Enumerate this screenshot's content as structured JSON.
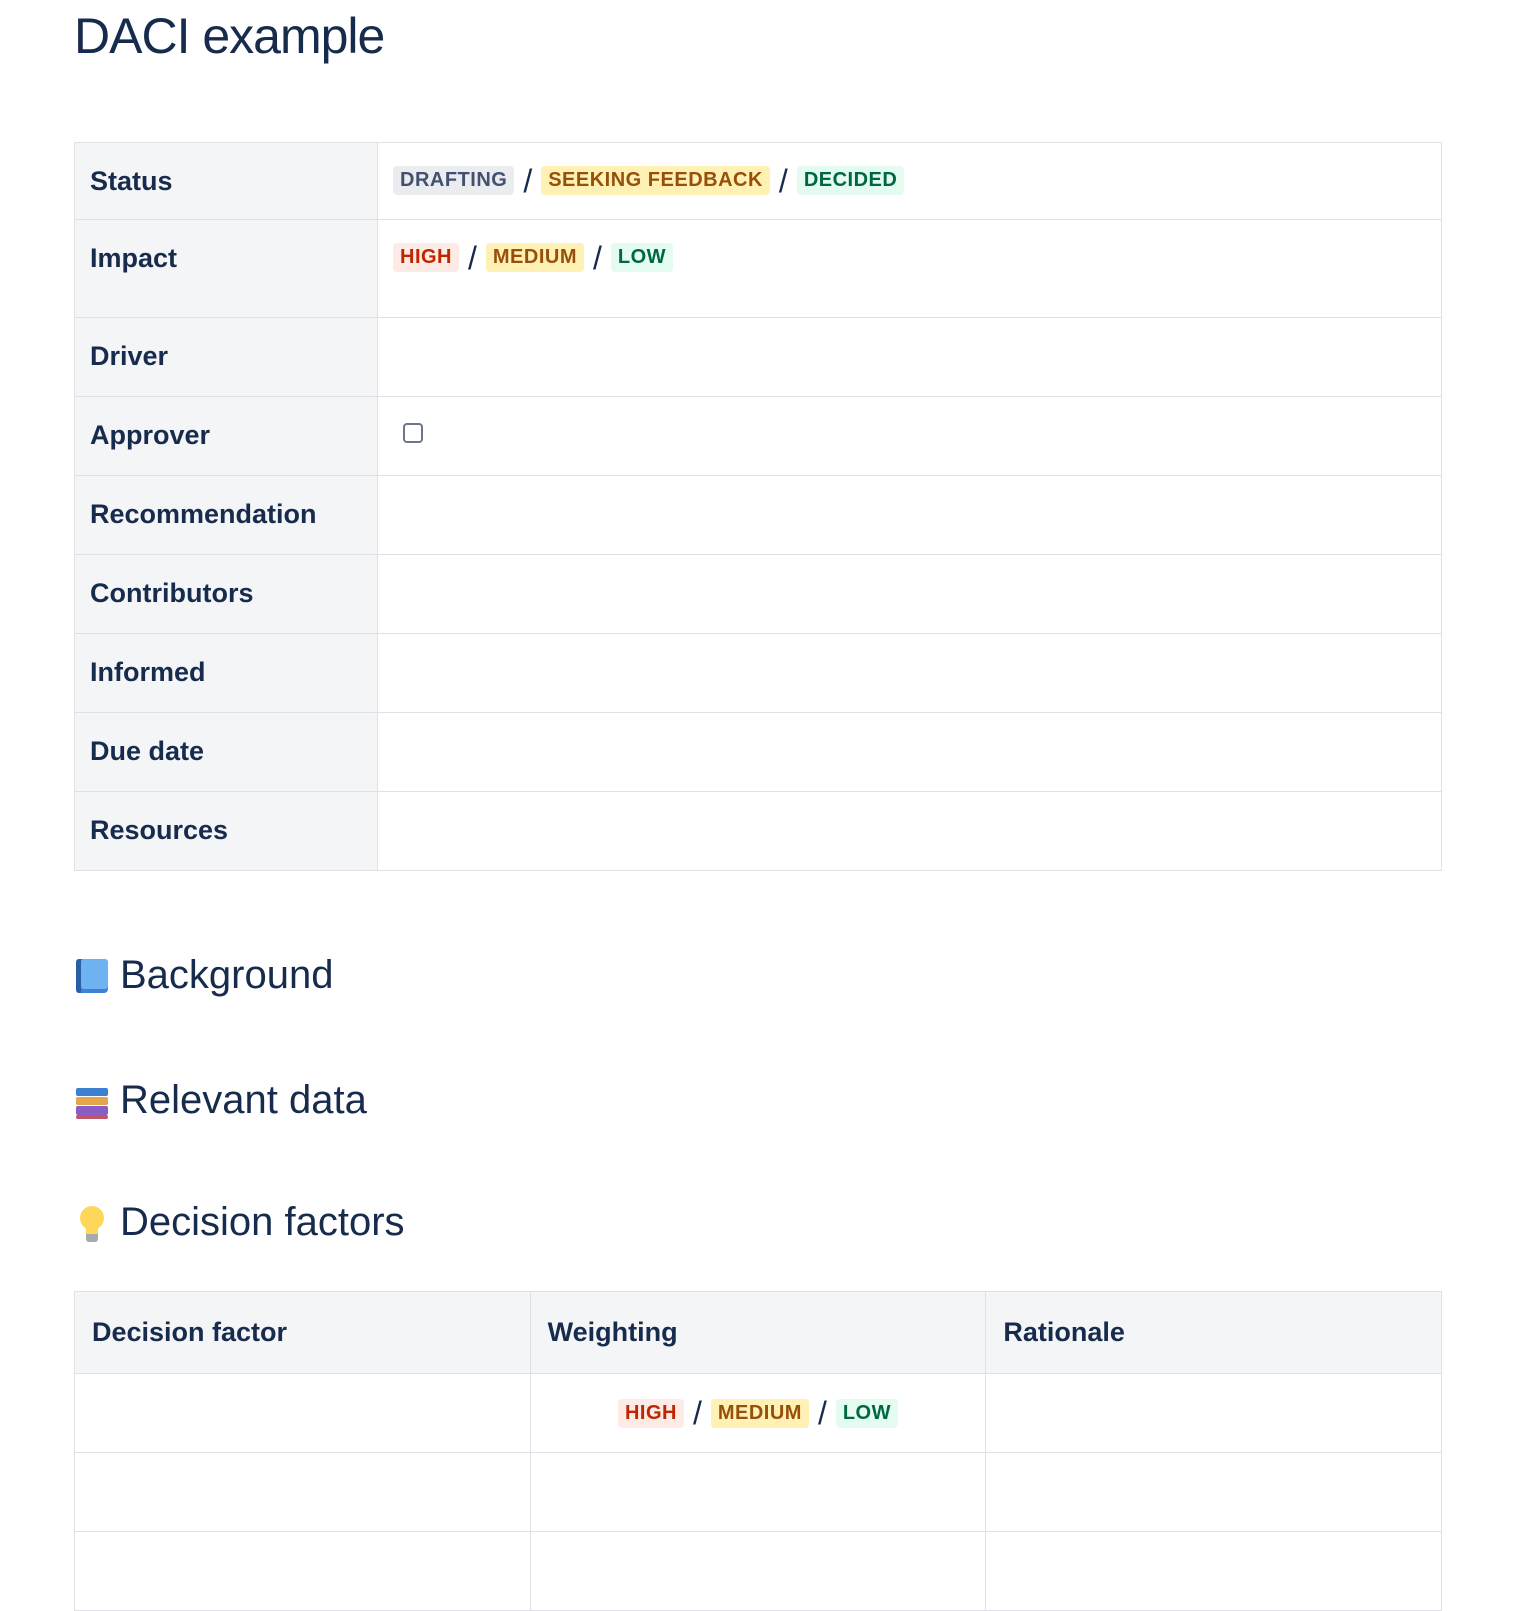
{
  "page": {
    "title": "DACI example"
  },
  "properties": {
    "status": {
      "label": "Status",
      "options": [
        "DRAFTING",
        "SEEKING FEEDBACK",
        "DECIDED"
      ]
    },
    "impact": {
      "label": "Impact",
      "options": [
        "HIGH",
        "MEDIUM",
        "LOW"
      ]
    },
    "driver": {
      "label": "Driver",
      "value": ""
    },
    "approver": {
      "label": "Approver",
      "checked": false
    },
    "recommendation": {
      "label": "Recommendation",
      "value": ""
    },
    "contributors": {
      "label": "Contributors",
      "value": ""
    },
    "informed": {
      "label": "Informed",
      "value": ""
    },
    "due_date": {
      "label": "Due date",
      "value": ""
    },
    "resources": {
      "label": "Resources",
      "value": ""
    },
    "separator": "/"
  },
  "sections": {
    "background": {
      "title": "Background",
      "icon": "blue-book-icon"
    },
    "relevant_data": {
      "title": "Relevant data",
      "icon": "books-icon"
    },
    "decision_factors": {
      "title": "Decision factors",
      "icon": "light-bulb-icon"
    }
  },
  "factors_table": {
    "headers": [
      "Decision factor",
      "Weighting",
      "Rationale"
    ],
    "rows": [
      {
        "factor": "",
        "weighting": [
          "HIGH",
          "MEDIUM",
          "LOW"
        ],
        "rationale": ""
      },
      {
        "factor": "",
        "weighting": [],
        "rationale": ""
      },
      {
        "factor": "",
        "weighting": [],
        "rationale": ""
      }
    ]
  },
  "colors": {
    "text": "#172B4D",
    "grey_lozenge_bg": "#EBECF0",
    "yellow_lozenge_bg": "#FFF0B3",
    "green_lozenge_bg": "#E3FCEF",
    "red_lozenge_bg": "#FFEBE6",
    "header_bg": "#F4F5F7",
    "border": "#DFE1E6"
  }
}
